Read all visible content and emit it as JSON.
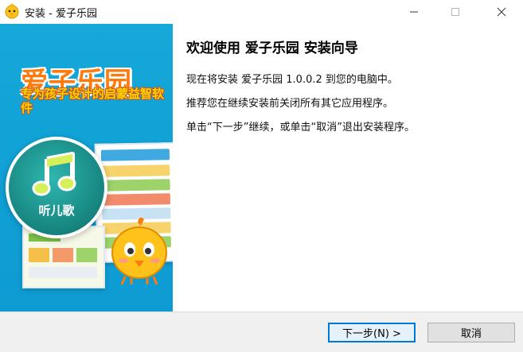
{
  "window": {
    "title": "安装 - 爱子乐园",
    "app_icon": "chick-face-icon",
    "controls": {
      "minimize": "minimize-icon",
      "maximize": "maximize-icon",
      "close": "close-icon"
    }
  },
  "banner": {
    "brand_title": "爱子乐园",
    "brand_subtitle": "专为孩子设计的启蒙益智软件",
    "music_badge_label": "听儿歌",
    "music_icon": "music-note-icon",
    "colors": {
      "background": "#11a2d6",
      "title": "#ff7a0a",
      "subtitle": "#ffd400",
      "badge": "#16837e"
    }
  },
  "content": {
    "heading": "欢迎使用 爱子乐园 安装向导",
    "line1": "现在将安装 爱子乐园 1.0.0.2 到您的电脑中。",
    "line2": "推荐您在继续安装前关闭所有其它应用程序。",
    "line3": "单击“下一步”继续，或单击“取消”退出安装程序。"
  },
  "footer": {
    "next_button": "下一步(N) >",
    "cancel_button": "取消"
  },
  "colors": {
    "accent": "#0078d7",
    "footer_bg": "#f0f0f0"
  }
}
